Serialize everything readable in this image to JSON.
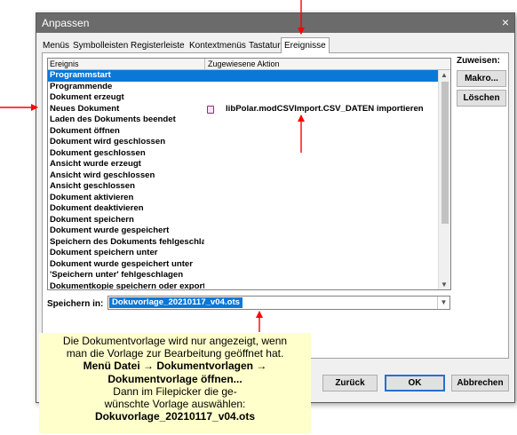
{
  "dialog": {
    "title": "Anpassen",
    "close_glyph": "×"
  },
  "tabs": [
    {
      "label": "Menüs"
    },
    {
      "label": "Symbolleisten"
    },
    {
      "label": "Registerleiste"
    },
    {
      "label": "Kontextmenüs"
    },
    {
      "label": "Tastatur"
    },
    {
      "label": "Ereignisse",
      "active": true
    }
  ],
  "events_list": {
    "col_event": "Ereignis",
    "col_action": "Zugewiesene Aktion",
    "rows": [
      {
        "event": "Programmstart",
        "action": ""
      },
      {
        "event": "Programmende",
        "action": ""
      },
      {
        "event": "Dokument erzeugt",
        "action": ""
      },
      {
        "event": "Neues Dokument",
        "action": "libPolar.modCSVImport.CSV_DATEN importieren"
      },
      {
        "event": "Laden des Dokuments beendet",
        "action": ""
      },
      {
        "event": "Dokument öffnen",
        "action": ""
      },
      {
        "event": "Dokument wird geschlossen",
        "action": ""
      },
      {
        "event": "Dokument geschlossen",
        "action": ""
      },
      {
        "event": "Ansicht wurde erzeugt",
        "action": ""
      },
      {
        "event": "Ansicht wird geschlossen",
        "action": ""
      },
      {
        "event": "Ansicht geschlossen",
        "action": ""
      },
      {
        "event": "Dokument aktivieren",
        "action": ""
      },
      {
        "event": "Dokument deaktivieren",
        "action": ""
      },
      {
        "event": "Dokument speichern",
        "action": ""
      },
      {
        "event": "Dokument wurde gespeichert",
        "action": ""
      },
      {
        "event": "Speichern des Dokuments fehlgeschlagen",
        "action": ""
      },
      {
        "event": "Dokument speichern unter",
        "action": ""
      },
      {
        "event": "Dokument wurde gespeichert unter",
        "action": ""
      },
      {
        "event": "'Speichern unter' fehlgeschlagen",
        "action": ""
      },
      {
        "event": "Dokumentkopie speichern oder exportieren",
        "action": ""
      }
    ],
    "selected_index": 0,
    "macro_row_index": 3,
    "selection_color": "#0a78d7"
  },
  "assign": {
    "label": "Zuweisen:",
    "macro_button": "Makro...",
    "delete_button": "Löschen"
  },
  "save_in": {
    "label": "Speichern in:",
    "value": "Dokuvorlage_20210117_v04.ots"
  },
  "footer": {
    "reset_button": "Zurück",
    "ok_button": "OK",
    "cancel_button": "Abbrechen"
  },
  "annotation": {
    "line1": "Die Dokumentvorlage wird nur angezeigt, wenn",
    "line2": "man die Vorlage zur Bearbeitung geöffnet hat.",
    "line3": "Menü  Datei → Dokumentvorlagen →",
    "line4": "Dokumentvorlage öffnen...",
    "line5": "Dann im Filepicker die ge-",
    "line6": "wünschte Vorlage auswählen:",
    "line7": "Dokuvorlage_20210117_v04.ots",
    "arrow_color": "#ff0000",
    "background": "#ffffcc"
  }
}
